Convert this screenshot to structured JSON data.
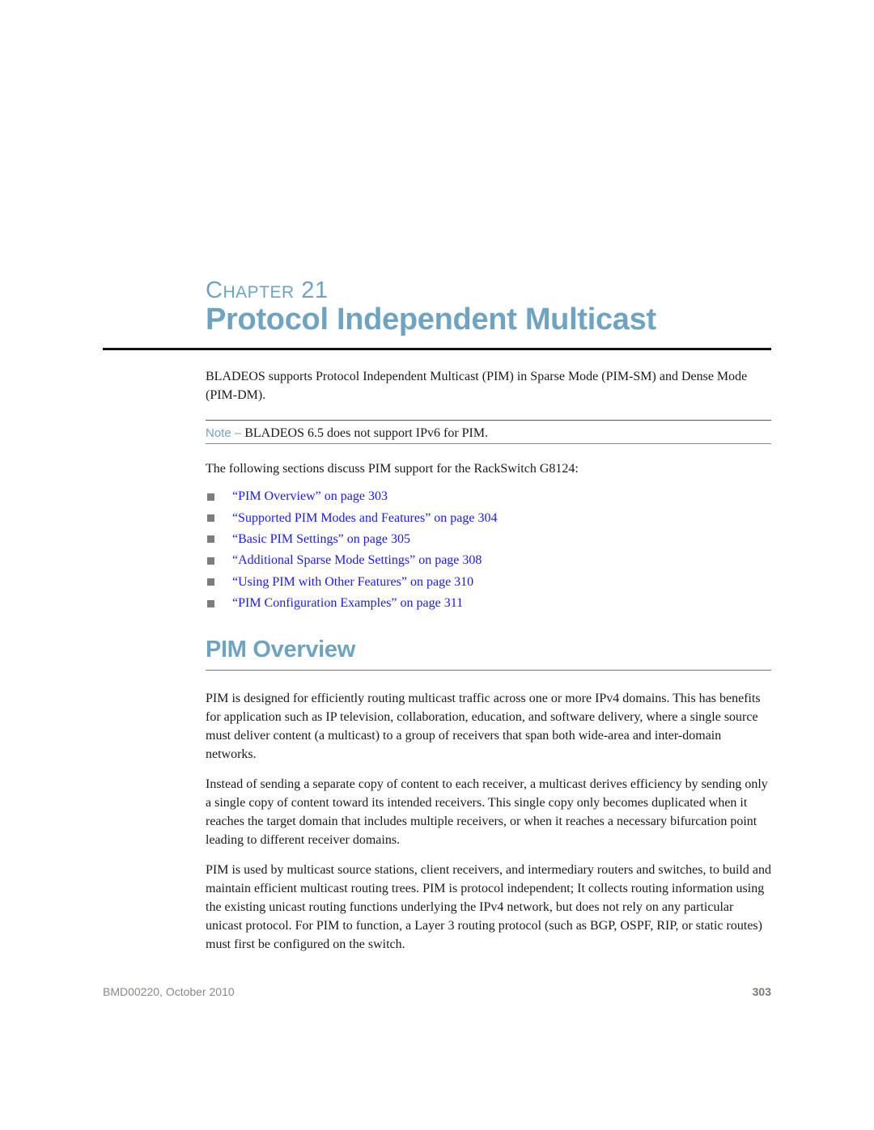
{
  "chapter": {
    "label_first": "C",
    "label_rest": "HAPTER",
    "number": "21",
    "title": "Protocol Independent Multicast"
  },
  "intro": {
    "text": "BLADEOS supports Protocol Independent Multicast (PIM) in Sparse Mode (PIM-SM) and Dense Mode (PIM-DM)."
  },
  "note": {
    "label": "Note –",
    "text": " BLADEOS 6.5 does not support IPv6 for PIM."
  },
  "lead": "The following sections discuss PIM support for the RackSwitch G8124:",
  "toc": [
    {
      "label": "“PIM Overview” on page 303"
    },
    {
      "label": "“Supported PIM Modes and Features” on page 304"
    },
    {
      "label": "“Basic PIM Settings” on page 305"
    },
    {
      "label": "“Additional Sparse Mode Settings” on page 308"
    },
    {
      "label": "“Using PIM with Other Features” on page 310"
    },
    {
      "label": "“PIM Configuration Examples” on page 311"
    }
  ],
  "section": {
    "title": "PIM Overview",
    "paragraphs": [
      "PIM is designed for efficiently routing multicast traffic across one or more IPv4 domains. This has benefits for application such as IP television, collaboration, education, and software delivery, where a single source must deliver content (a multicast) to a group of receivers that span both wide-area and inter-domain networks.",
      "Instead of sending a separate copy of content to each receiver, a multicast derives efficiency by sending only a single copy of content toward its intended receivers. This single copy only becomes duplicated when it reaches the target domain that includes multiple receivers, or when it reaches a necessary bifurcation point leading to different receiver domains.",
      "PIM is used by multicast source stations, client receivers, and intermediary routers and switches, to build and maintain efficient multicast routing trees. PIM is protocol independent; It collects routing information using the existing unicast routing functions underlying the IPv4 network, but does not rely on any particular unicast protocol. For PIM to function, a Layer 3 routing protocol (such as BGP, OSPF, RIP, or static routes) must first be configured on the switch."
    ]
  },
  "footer": {
    "doc_id": "BMD00220, October 2010",
    "page_number": "303"
  },
  "colors": {
    "heading": "#6fa3c2",
    "link": "#1a1aff",
    "bullet": "#7d7d7d",
    "footer": "#8a8a80"
  }
}
